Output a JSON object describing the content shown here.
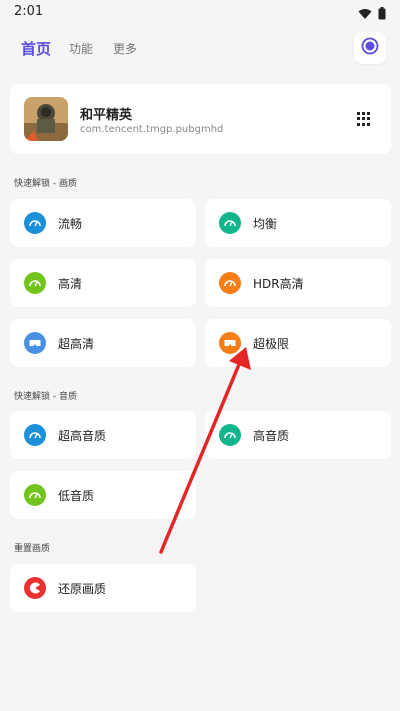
{
  "status": {
    "time": "2:01"
  },
  "nav": {
    "tabs": [
      {
        "label": "首页"
      },
      {
        "label": "功能"
      },
      {
        "label": "更多"
      }
    ]
  },
  "game": {
    "name": "和平精英",
    "package": "com.tencent.tmgp.pubgmhd"
  },
  "sections": {
    "video": "快速解锁 - 画质",
    "audio": "快速解锁 - 音质",
    "restore": "重置画质"
  },
  "video_options": [
    {
      "label": "流畅",
      "color": "#1b8fd8"
    },
    {
      "label": "均衡",
      "color": "#13b58c"
    },
    {
      "label": "高清",
      "color": "#73c31d"
    },
    {
      "label": "HDR高清",
      "color": "#f57e18"
    },
    {
      "label": "超高清",
      "color": "#4a90e2"
    },
    {
      "label": "超极限",
      "color": "#f57e18"
    }
  ],
  "audio_options": [
    {
      "label": "超高音质",
      "color": "#1b8fd8"
    },
    {
      "label": "高音质",
      "color": "#13b58c"
    },
    {
      "label": "低音质",
      "color": "#73c31d"
    }
  ],
  "restore_option": {
    "label": "还原画质",
    "color": "#e8302f"
  },
  "colors": {
    "accent": "#5b4fd9",
    "arrow": "#e32626"
  }
}
